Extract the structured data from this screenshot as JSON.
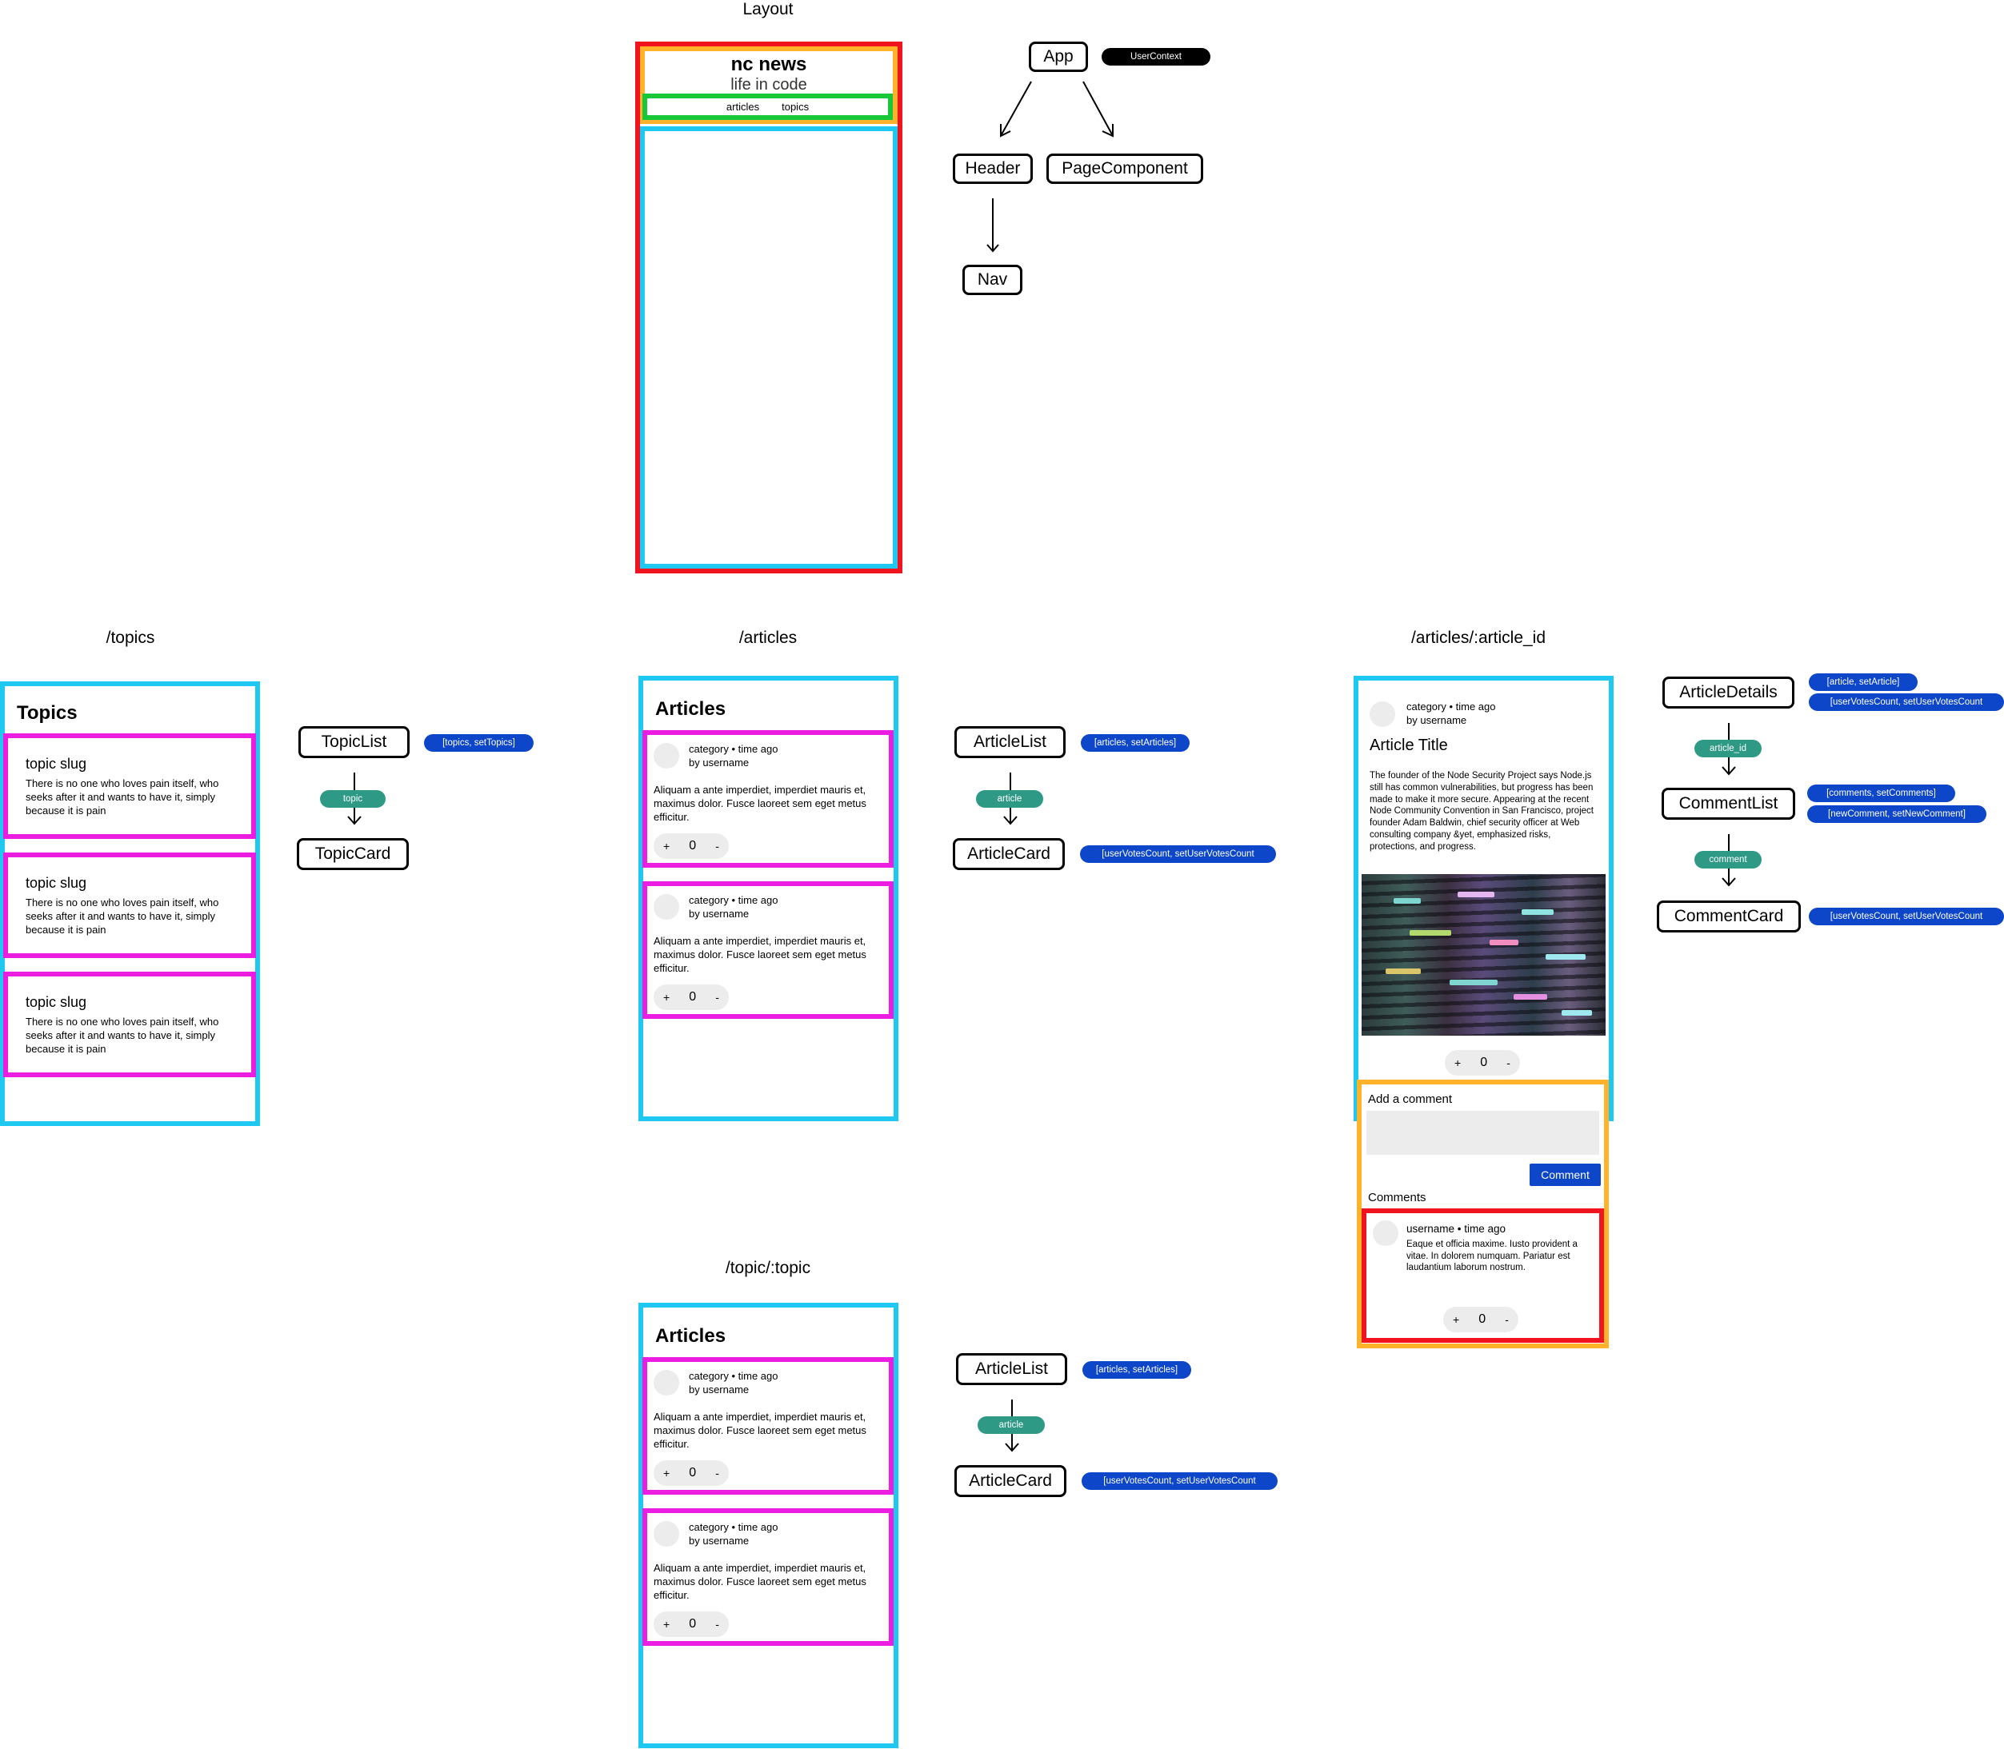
{
  "sections": {
    "layout": "Layout",
    "topics": "/topics",
    "articles": "/articles",
    "article_id": "/articles/:article_id",
    "topic_topic": "/topic/:topic"
  },
  "layout_mock": {
    "site_title": "nc news",
    "tagline": "life in code",
    "nav": [
      "articles",
      "topics"
    ]
  },
  "layout_tree": {
    "app": "App",
    "context": "UserContext",
    "header": "Header",
    "page_component": "PageComponent",
    "nav": "Nav"
  },
  "topics_page": {
    "heading": "Topics",
    "cards": [
      {
        "title": "topic slug",
        "body": "There is no one who loves pain itself, who seeks after it and wants to have it, simply because it is pain"
      },
      {
        "title": "topic slug",
        "body": "There is no one who loves pain itself, who seeks after it and wants to have it, simply because it is pain"
      },
      {
        "title": "topic slug",
        "body": "There is no one who loves pain itself, who seeks after it and wants to have it, simply because it is pain"
      }
    ]
  },
  "topics_tree": {
    "list": "TopicList",
    "list_state": "[topics, setTopics]",
    "prop": "topic",
    "card": "TopicCard"
  },
  "articles_page": {
    "heading": "Articles",
    "cards": [
      {
        "meta1": "category • time ago",
        "meta2": "by username",
        "body": "Aliquam a ante imperdiet, imperdiet mauris et, maximus dolor. Fusce laoreet sem eget metus efficitur.",
        "plus": "+",
        "count": "0",
        "minus": "-"
      },
      {
        "meta1": "category • time ago",
        "meta2": "by username",
        "body": "Aliquam a ante imperdiet, imperdiet mauris et, maximus dolor. Fusce laoreet sem eget metus efficitur.",
        "plus": "+",
        "count": "0",
        "minus": "-"
      }
    ]
  },
  "articles_tree": {
    "list": "ArticleList",
    "list_state": "[articles, setArticles]",
    "prop": "article",
    "card": "ArticleCard",
    "card_state": "[userVotesCount, setUserVotesCount"
  },
  "topic_page": {
    "heading": "Articles",
    "cards": [
      {
        "meta1": "category • time ago",
        "meta2": "by username",
        "body": "Aliquam a ante imperdiet, imperdiet mauris et, maximus dolor. Fusce laoreet sem eget metus efficitur.",
        "plus": "+",
        "count": "0",
        "minus": "-"
      },
      {
        "meta1": "category • time ago",
        "meta2": "by username",
        "body": "Aliquam a ante imperdiet, imperdiet mauris et, maximus dolor. Fusce laoreet sem eget metus efficitur.",
        "plus": "+",
        "count": "0",
        "minus": "-"
      }
    ]
  },
  "topic_tree": {
    "list": "ArticleList",
    "list_state": "[articles, setArticles]",
    "prop": "article",
    "card": "ArticleCard",
    "card_state": "[userVotesCount, setUserVotesCount"
  },
  "article_page": {
    "meta1": "category • time ago",
    "meta2": "by username",
    "title": "Article Title",
    "body": "The founder of the Node Security Project says Node.js still has common vulnerabilities, but progress has been made to make it more secure. Appearing at the recent Node Community Convention in San Francisco, project founder Adam Baldwin, chief security officer at Web consulting company &yet, emphasized risks, protections, and progress.",
    "plus": "+",
    "count": "0",
    "minus": "-",
    "add_comment_label": "Add a comment",
    "comment_button": "Comment",
    "comments_heading": "Comments",
    "comment": {
      "meta": "username • time ago",
      "body": "Eaque et officia maxime. Iusto provident a vitae. In dolorem numquam. Pariatur est laudantium laborum nostrum.",
      "plus": "+",
      "count": "0",
      "minus": "-"
    }
  },
  "article_tree": {
    "details": "ArticleDetails",
    "details_state_1": "[article, setArticle]",
    "details_state_2": "[userVotesCount, setUserVotesCount",
    "prop1": "article_id",
    "list": "CommentList",
    "list_state_1": "[comments, setComments]",
    "list_state_2": "[newComment, setNewComment]",
    "prop2": "comment",
    "card": "CommentCard",
    "card_state": "[userVotesCount, setUserVotesCount"
  },
  "colors": {
    "app": "#f0141e",
    "header": "#ffb22a",
    "nav": "#19c838",
    "page": "#1ec8f0",
    "card": "#ea1de0",
    "state_pill": "#0d46c9",
    "prop_pill": "#2e9a86"
  }
}
